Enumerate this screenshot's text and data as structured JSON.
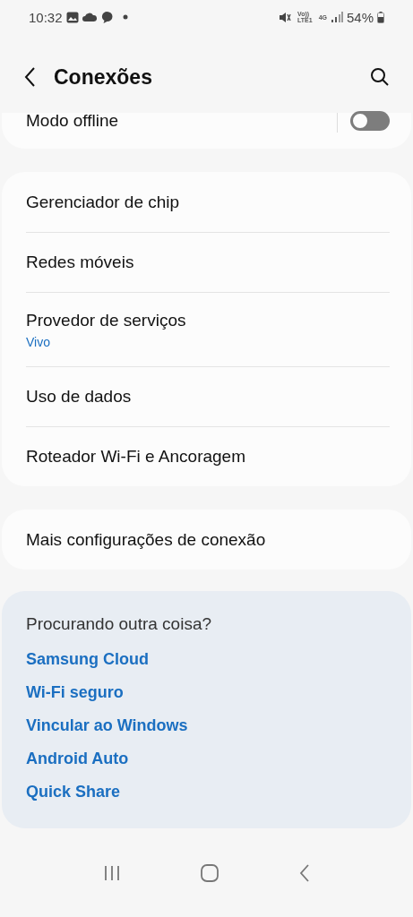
{
  "status_bar": {
    "time": "10:32",
    "volte": "Vo))",
    "lte": "LTE1",
    "network": "4G",
    "battery": "54%"
  },
  "header": {
    "title": "Conexões"
  },
  "top_item": {
    "label": "Modo offline",
    "on": false
  },
  "groups": [
    {
      "items": [
        {
          "label": "Gerenciador de chip"
        },
        {
          "label": "Redes móveis"
        },
        {
          "label": "Provedor de serviços",
          "sub": "Vivo"
        },
        {
          "label": "Uso de dados"
        },
        {
          "label": "Roteador Wi-Fi e Ancoragem"
        }
      ]
    },
    {
      "items": [
        {
          "label": "Mais configurações de conexão"
        }
      ]
    }
  ],
  "suggestions": {
    "title": "Procurando outra coisa?",
    "links": [
      "Samsung Cloud",
      "Wi-Fi seguro",
      "Vincular ao Windows",
      "Android Auto",
      "Quick Share"
    ]
  }
}
